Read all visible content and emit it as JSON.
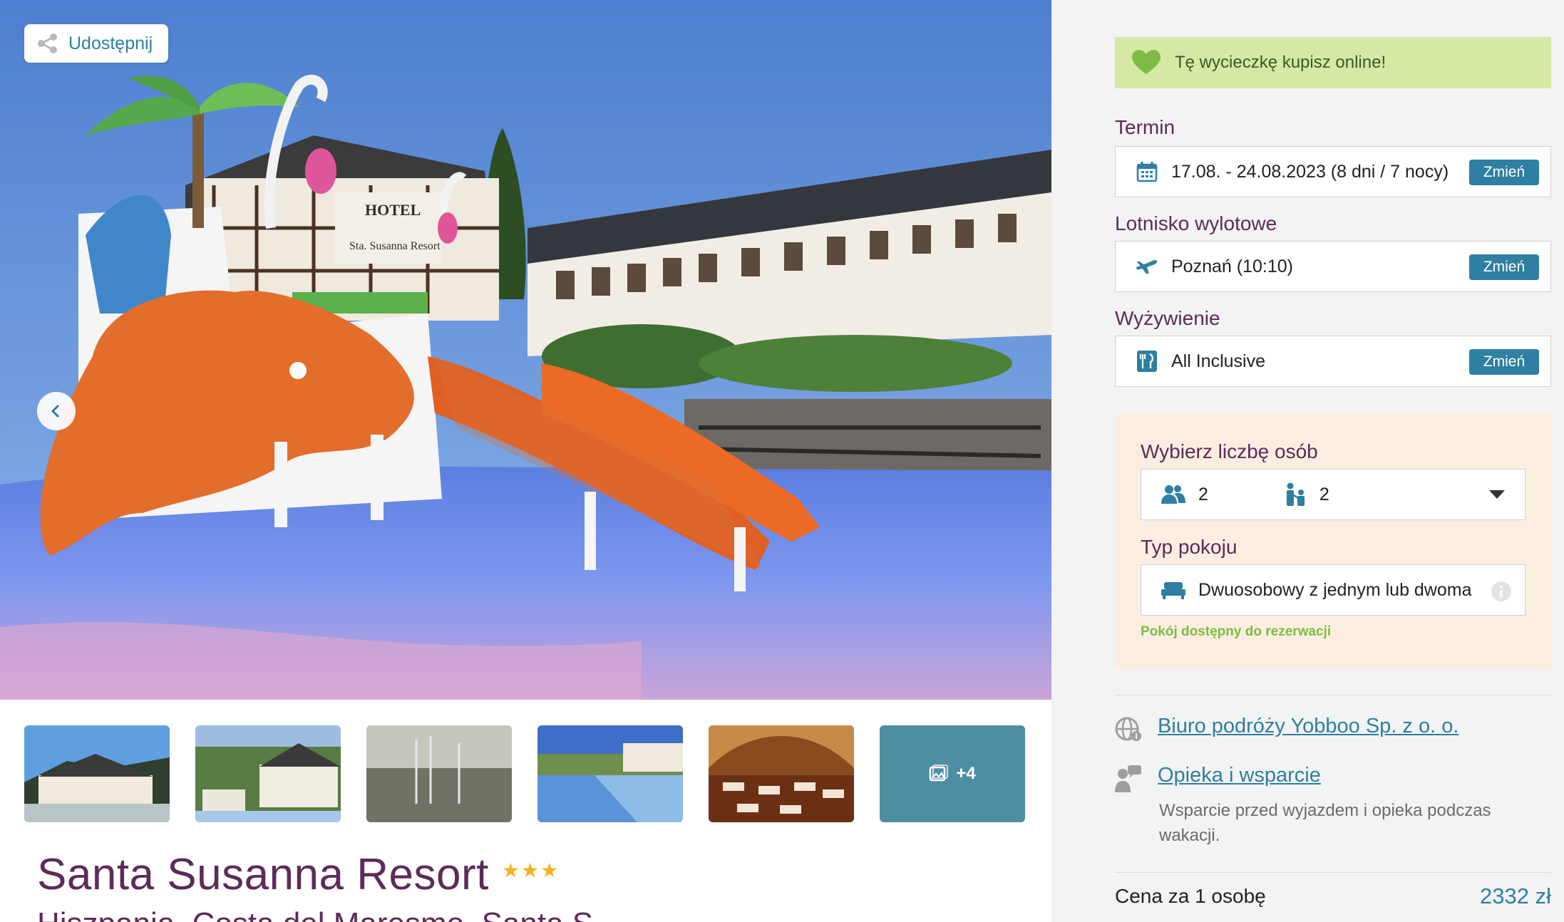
{
  "hero": {
    "share_label": "Udostępnij",
    "sign_hotel": "HOTEL",
    "sign_name": "Sta. Susanna Resort"
  },
  "gallery": {
    "more_count": "+4"
  },
  "hotel": {
    "name": "Santa Susanna Resort",
    "stars": "★★★",
    "location": "Hiszpania, Costa del Maresme, Santa S..."
  },
  "booking": {
    "online_banner": "Tę wycieczkę kupisz online!",
    "change_label": "Zmień",
    "term": {
      "label": "Termin",
      "value": "17.08. - 24.08.2023 (8 dni / 7 nocy)"
    },
    "airport": {
      "label": "Lotnisko wylotowe",
      "value": "Poznań (10:10)"
    },
    "board": {
      "label": "Wyżywienie",
      "value": "All Inclusive"
    },
    "persons": {
      "label": "Wybierz liczbę osób",
      "adults": "2",
      "children": "2"
    },
    "room": {
      "label": "Typ pokoju",
      "value": "Dwuosobowy z jednym lub dwoma",
      "availability": "Pokój dostępny do rezerwacji"
    }
  },
  "links": {
    "agency": "Biuro podróży Yobboo Sp. z o. o.",
    "support": "Opieka i wsparcie",
    "support_desc": "Wsparcie przed wyjazdem i opieka podczas wakacji."
  },
  "price": {
    "label": "Cena za 1 osobę",
    "value": "2332 zł"
  },
  "colors": {
    "accent": "#2e7fa1",
    "heading": "#5d2a5a",
    "banner": "#d5e8a4",
    "panel": "#fbeee0",
    "available": "#7dbb44",
    "stars": "#f4b321"
  },
  "icons": [
    "share-icon",
    "chevron-left-icon",
    "gallery-icon",
    "heart-icon",
    "calendar-icon",
    "plane-icon",
    "cutlery-icon",
    "adults-icon",
    "children-icon",
    "dropdown-arrow-icon",
    "bed-icon",
    "info-icon",
    "globe-icon",
    "support-icon"
  ]
}
